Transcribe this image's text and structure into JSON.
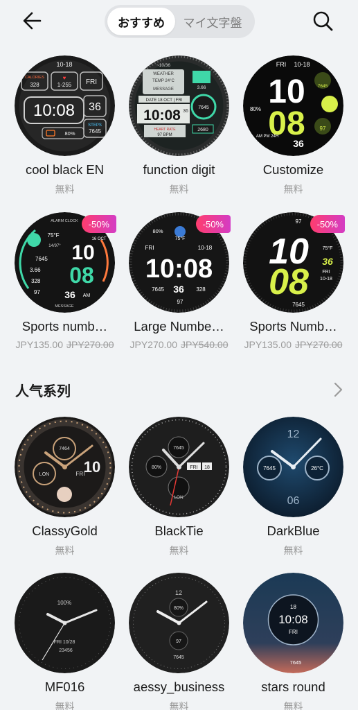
{
  "header": {
    "tabs": [
      "おすすめ",
      "マイ文字盤"
    ],
    "active_tab": 0
  },
  "recommended": [
    {
      "name": "cool black EN",
      "price": "無料",
      "old_price": null,
      "badge": null
    },
    {
      "name": "function digit",
      "price": "無料",
      "old_price": null,
      "badge": null
    },
    {
      "name": "Customize",
      "price": "無料",
      "old_price": null,
      "badge": null
    },
    {
      "name": "Sports numb…",
      "price": "JPY135.00",
      "old_price": "JPY270.00",
      "badge": "-50%"
    },
    {
      "name": "Large Numbe…",
      "price": "JPY270.00",
      "old_price": "JPY540.00",
      "badge": "-50%"
    },
    {
      "name": "Sports Numb…",
      "price": "JPY135.00",
      "old_price": "JPY270.00",
      "badge": "-50%"
    }
  ],
  "popular": {
    "title": "人气系列",
    "items": [
      {
        "name": "ClassyGold",
        "price": "無料"
      },
      {
        "name": "BlackTie",
        "price": "無料"
      },
      {
        "name": "DarkBlue",
        "price": "無料"
      },
      {
        "name": "MF016",
        "price": "無料"
      },
      {
        "name": "aessy_business",
        "price": "無料"
      },
      {
        "name": "stars round",
        "price": "無料"
      }
    ]
  },
  "faces": {
    "f1": {
      "date": "10-18",
      "cal_label": "CALORIES",
      "cal": "328",
      "hr": "1-255",
      "day": "FRI",
      "time": "10:08",
      "num": "36",
      "steps_label": "STEPS",
      "steps": "7645",
      "batt": "80%"
    },
    "f2": {
      "date": "~10/36",
      "weather": "WEATHER",
      "temp": "TEMP 24°C",
      "msg": "MESSAGE",
      "date2": "DATE 18 OCT | FRI",
      "time": "10:08",
      "sec": "36",
      "hr_label": "HEART RATE",
      "hr": "97 BPM",
      "dist": "3.66",
      "steps": "7645",
      "alt": "2680"
    },
    "f3": {
      "day": "FRI",
      "date": "10-18",
      "hh": "10",
      "mm": "08",
      "steps": "7645",
      "batt": "80%",
      "hr": "97",
      "ss": "36",
      "ampm": "AM PM 24H"
    },
    "f4": {
      "alarm": "ALARM CLOCK",
      "temp": "75°F",
      "range": "14/97°",
      "hh": "10",
      "date": "16 OCT",
      "mm": "08",
      "ss": "36",
      "ampm": "AM",
      "steps": "7645",
      "dist": "3.66",
      "kcal": "328",
      "bpm": "97",
      "msg": "MESSAGE"
    },
    "f5": {
      "batt": "80%",
      "temp": "75°F",
      "day": "FRI",
      "date": "10-18",
      "time": "10:08",
      "steps": "7645",
      "ss": "36",
      "kcal": "328",
      "hr": "97"
    },
    "f6": {
      "hr": "97",
      "hh": "10",
      "mm": "08",
      "temp": "75°F",
      "day": "FRI",
      "date": "10-18",
      "ss": "36",
      "steps": "7645"
    },
    "f7": {
      "steps": "7464",
      "num": "10",
      "lon": "LON",
      "day": "FRI"
    },
    "f8": {
      "top": "7645",
      "batt": "80%",
      "day": "FRI",
      "date": "18",
      "lon": "LON"
    },
    "f9": {
      "top": "12",
      "left": "7645",
      "right": "26°C",
      "bottom": "06"
    },
    "f10": {
      "batt": "100%",
      "date": "FRI 10/28",
      "steps": "23456"
    },
    "f11": {
      "top": "12",
      "batt": "80%",
      "hr": "97",
      "steps": "7645"
    },
    "f12": {
      "date": "18",
      "time": "10:08",
      "day": "FRI",
      "steps": "7645"
    }
  },
  "colors": {
    "background": "#f1f3f5",
    "badge_start": "#ff3d6e",
    "badge_end": "#d43cc4",
    "neon_yellow": "#d8f04a",
    "mint": "#3fd8a8",
    "gold": "#c9a27a"
  }
}
